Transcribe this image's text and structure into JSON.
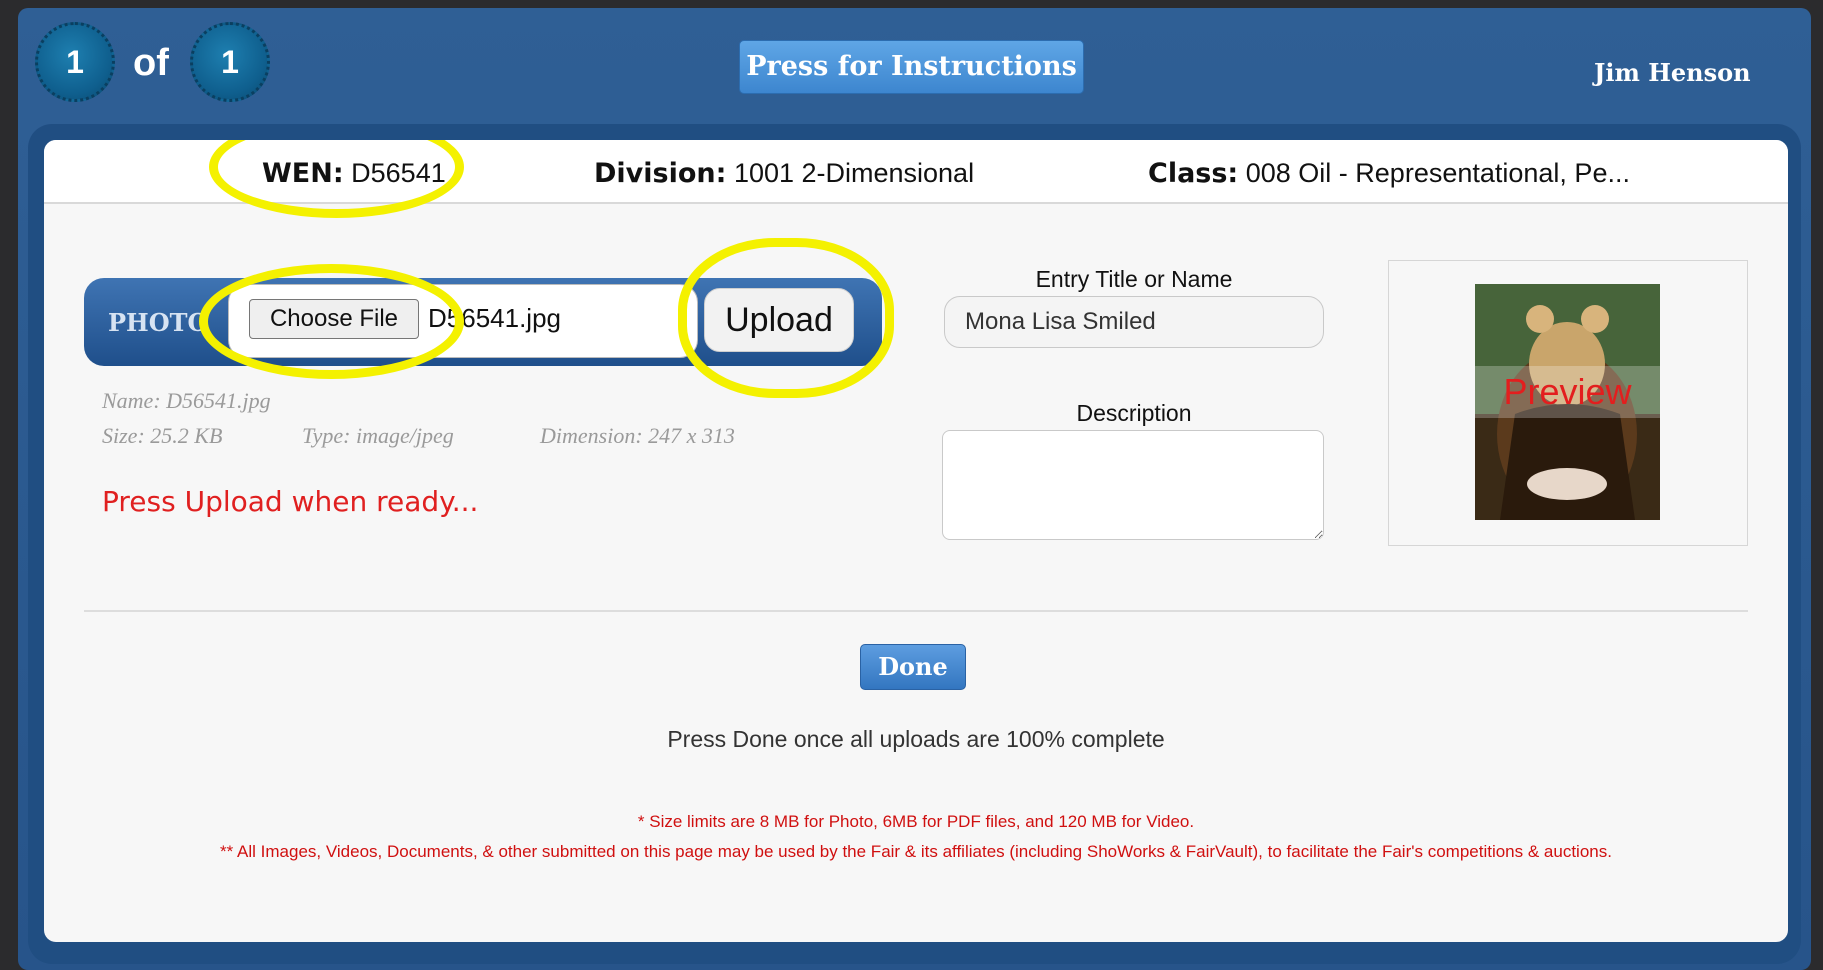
{
  "header": {
    "current_page": "1",
    "of_label": "of",
    "total_pages": "1",
    "instructions_button": "Press for Instructions",
    "user_name": "Jim Henson"
  },
  "entry_info": {
    "wen_label": "WEN:",
    "wen_value": "D56541",
    "division_label": "Division:",
    "division_value": "1001 2-Dimensional",
    "class_label": "Class:",
    "class_value": "008 Oil - Representational, Pe..."
  },
  "photo_upload": {
    "section_label": "PHOTO",
    "choose_file_button": "Choose File",
    "selected_file": "D56541.jpg",
    "upload_button": "Upload",
    "file_name_line": "Name: D56541.jpg",
    "file_size_line": "Size: 25.2 KB",
    "file_type_line": "Type: image/jpeg",
    "file_dimension_line": "Dimension: 247 x 313",
    "status_message": "Press Upload when ready..."
  },
  "entry_form": {
    "title_label": "Entry Title or Name",
    "title_value": "Mona Lisa Smiled",
    "description_label": "Description",
    "description_value": ""
  },
  "preview": {
    "label": "Preview"
  },
  "footer": {
    "done_button": "Done",
    "done_hint": "Press Done once all uploads are 100% complete",
    "size_limit_note": "* Size limits are 8 MB for Photo, 6MB for PDF files, and 120 MB for Video.",
    "usage_note": "** All Images, Videos, Documents, & other submitted on this page may be used by the Fair & its affiliates (including ShoWorks & FairVault), to facilitate the Fair's competitions & auctions."
  },
  "colors": {
    "highlight": "#f4f100",
    "status_red": "#e02020",
    "button_blue": "#3d86cf"
  }
}
